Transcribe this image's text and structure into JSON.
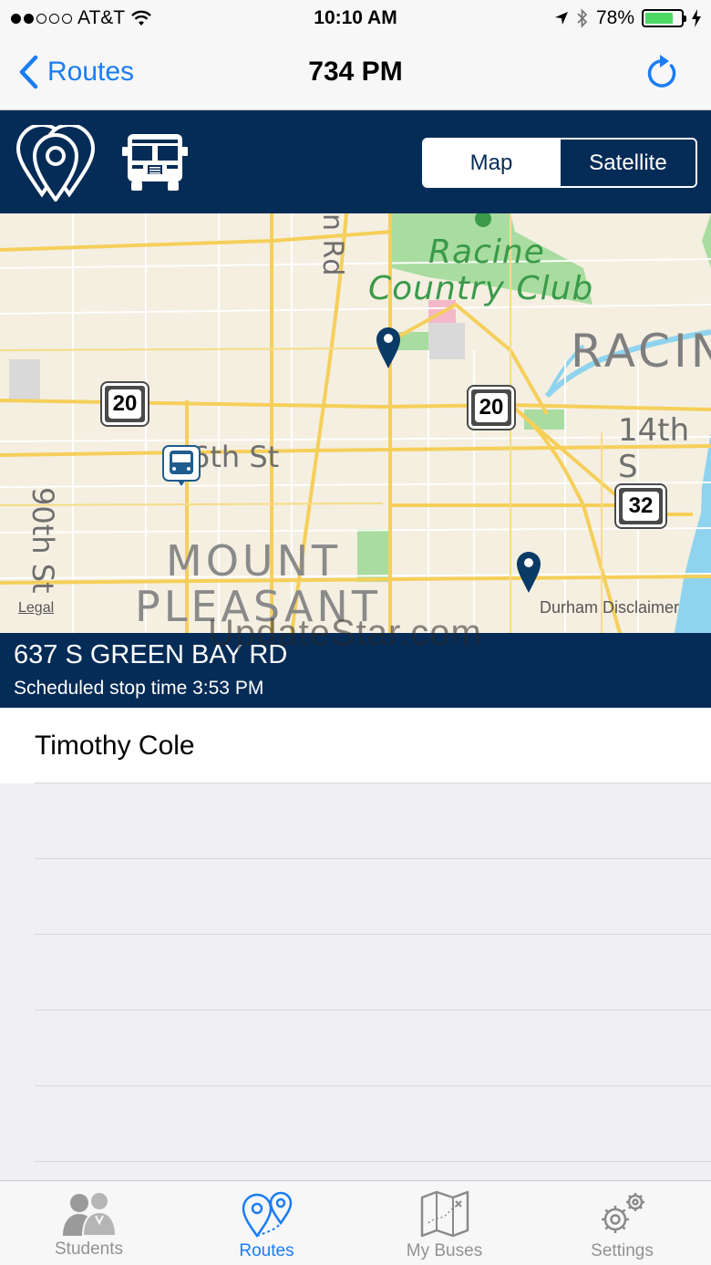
{
  "status_bar": {
    "carrier": "AT&T",
    "time": "10:10 AM",
    "battery": "78%",
    "battery_level": 0.78
  },
  "nav": {
    "back_label": "Routes",
    "title": "734 PM"
  },
  "map_toggle": {
    "map_label": "Map",
    "satellite_label": "Satellite",
    "selected": "Map"
  },
  "map": {
    "labels": {
      "club_line1": "Racine",
      "club_line2": "Country Club",
      "city": "RACIN",
      "street_14th": "14th S",
      "street_16th": "6th St",
      "street_90th": "90th St",
      "street_rd": "n Rd",
      "area_line1": "MOUNT",
      "area_line2": "PLEASANT",
      "legal": "Legal",
      "durham": "Durham Disclaimer"
    },
    "shields": {
      "hwy_a": "20",
      "hwy_b": "20",
      "hwy_c": "32"
    }
  },
  "stop": {
    "address": "637 S GREEN BAY RD",
    "scheduled": "Scheduled stop time 3:53 PM"
  },
  "watermark": "UpdateStar.com",
  "students": [
    "Timothy Cole"
  ],
  "tabs": [
    {
      "label": "Students",
      "icon": "students-icon"
    },
    {
      "label": "Routes",
      "icon": "routes-icon"
    },
    {
      "label": "My Buses",
      "icon": "map-icon"
    },
    {
      "label": "Settings",
      "icon": "gear-icon"
    }
  ],
  "colors": {
    "brand_navy": "#052c57",
    "ios_blue": "#1a7cf5",
    "map_road": "#f5cf5a",
    "park_green": "#a9dca0"
  }
}
